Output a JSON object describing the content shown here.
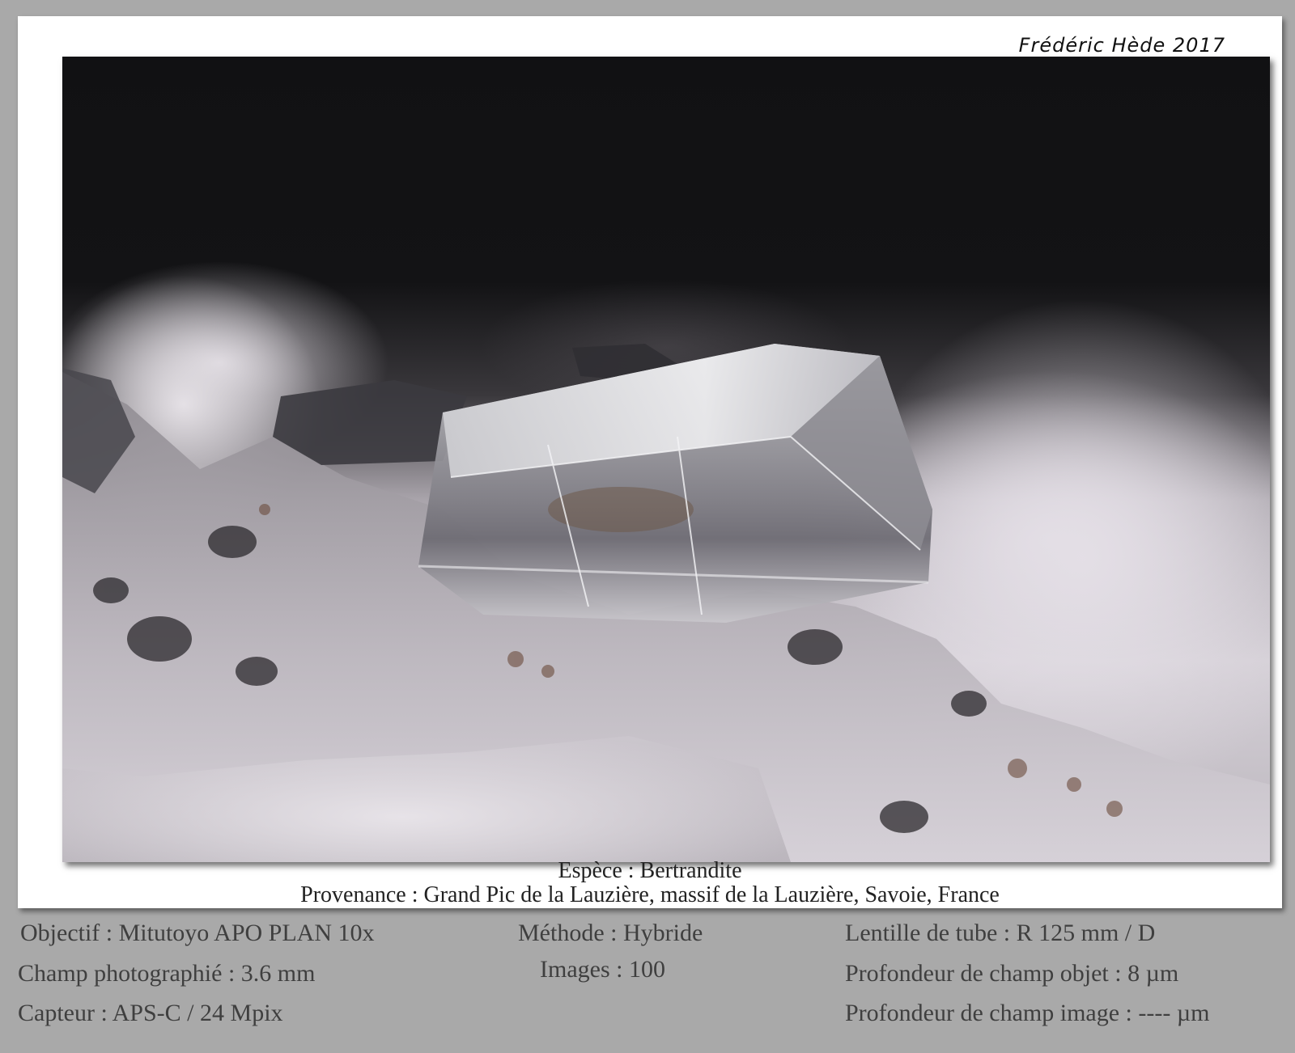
{
  "signature": "Frédéric Hède 2017",
  "caption": {
    "species": "Espèce : Bertrandite",
    "origin": "Provenance : Grand Pic de la Lauzière, massif de la Lauzière, Savoie, France"
  },
  "specs": {
    "left": [
      "Objectif : Mitutoyo APO PLAN 10x",
      "Champ photographié : 3.6 mm",
      "Capteur : APS-C / 24 Mpix"
    ],
    "middle": [
      "Méthode : Hybride",
      "Images : 100"
    ],
    "right": [
      "Lentille de tube : R 125 mm / D",
      "Profondeur de champ objet : 8 µm",
      "Profondeur de champ image : ---- µm"
    ]
  },
  "colors": {
    "background": "#a9a9a9",
    "card": "#ffffff",
    "photo_dark": "#111113",
    "matrix_light": "#d5d0d7",
    "spec_text": "#3f3f3f"
  }
}
